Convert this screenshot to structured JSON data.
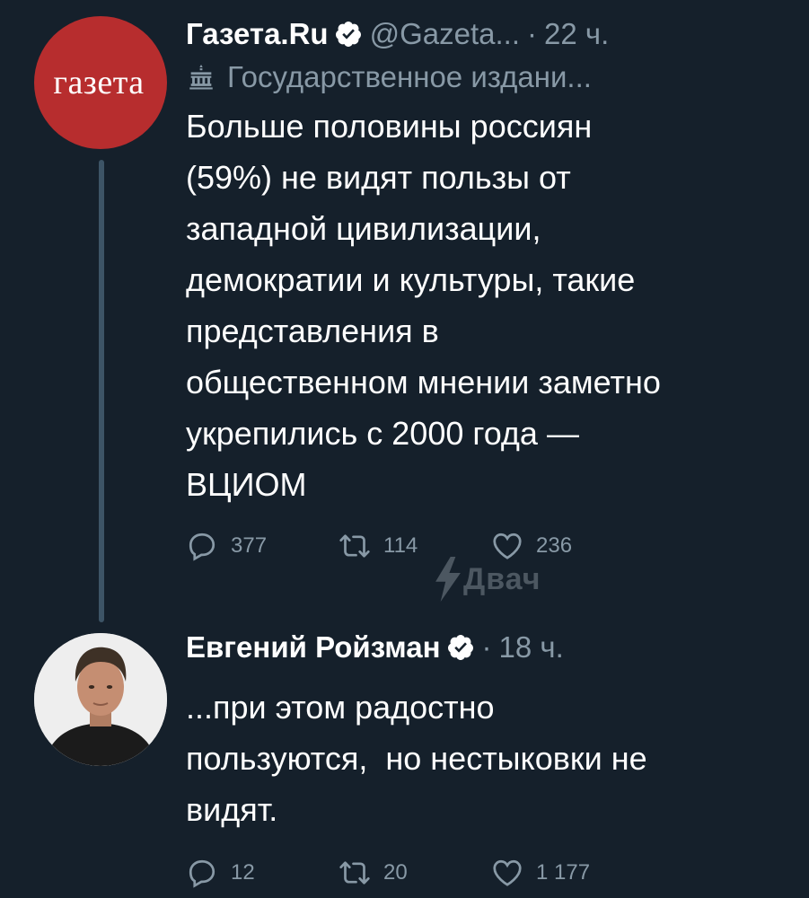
{
  "tweets": [
    {
      "avatar_text": "газета",
      "author_name": "Газета.Ru",
      "handle": "@Gazeta...",
      "separator": "·",
      "time": "22 ч.",
      "label": "Государственное издани...",
      "text": "Больше половины россиян\n(59%) не видят пользы от\nзападной цивилизации,\nдемократии и культуры, такие\nпредставления в\nобщественном мнении заметно\nукрепились с 2000 года —\nВЦИОМ",
      "replies": "377",
      "retweets": "114",
      "likes": "236"
    },
    {
      "author_name": "Евгений Ройзман",
      "separator": "·",
      "time": "18 ч.",
      "text": "...при этом радостно\nпользуются,  но нестыковки не\nвидят.",
      "replies": "12",
      "retweets": "20",
      "likes": "1 177"
    }
  ],
  "watermark": "Двач",
  "icons": {
    "verified": "verified-badge-icon",
    "government_label": "government-building-icon",
    "reply": "reply-icon",
    "retweet": "retweet-icon",
    "like": "heart-icon"
  },
  "colors": {
    "background": "#15202b",
    "muted_text": "#8899a6",
    "gazeta_red": "#b72d2e",
    "thread_line": "#3d5466"
  }
}
